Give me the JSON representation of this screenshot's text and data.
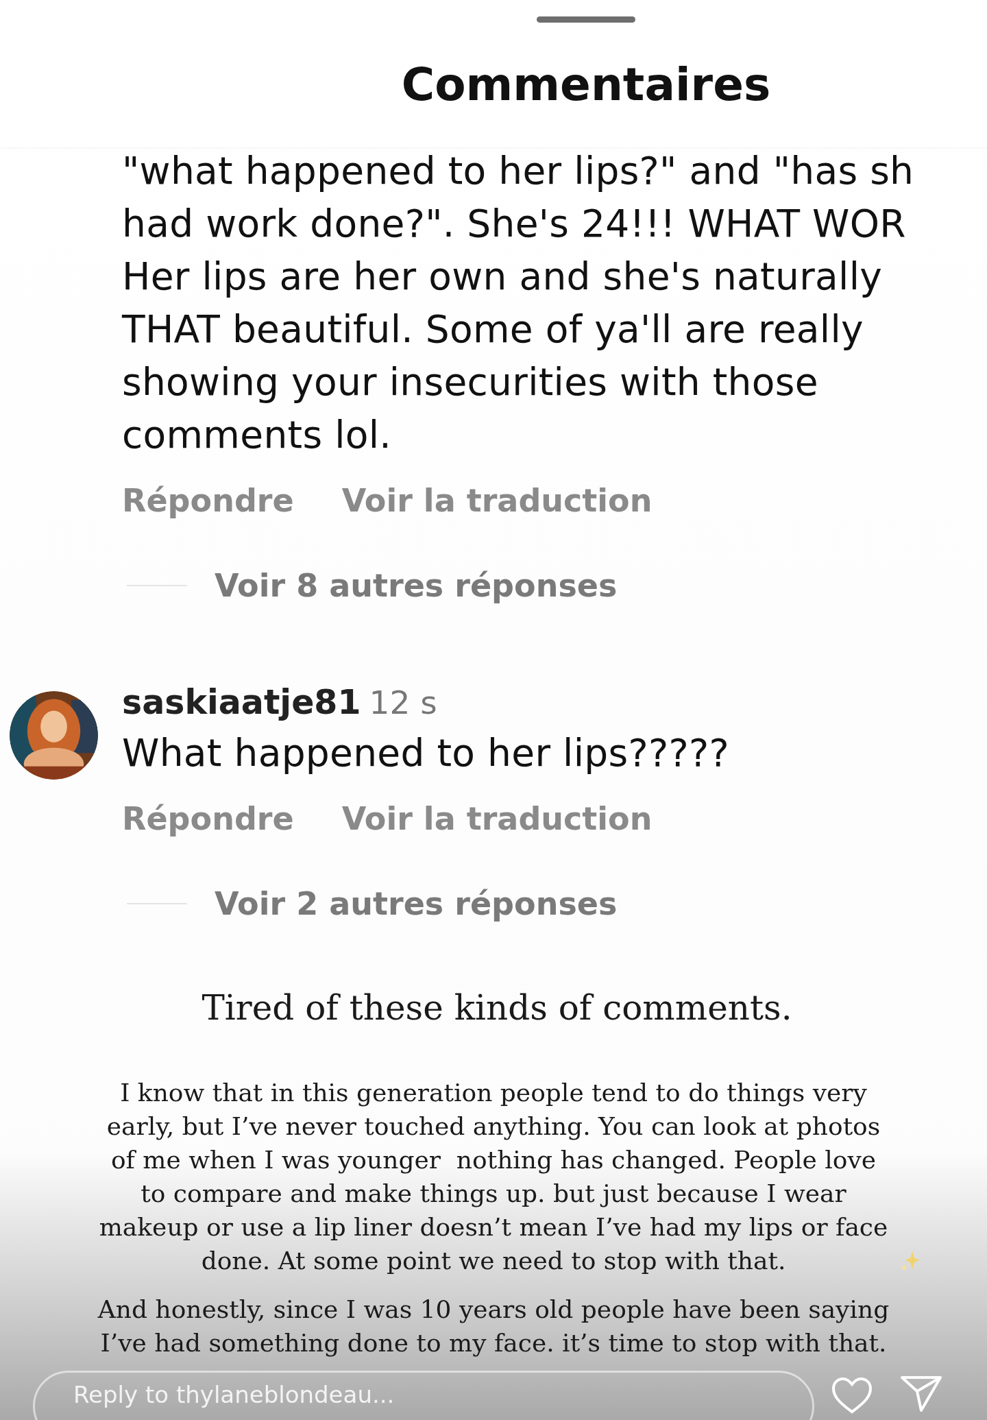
{
  "header": {
    "title": "Commentaires"
  },
  "comments": [
    {
      "has_avatar": false,
      "text": "\"what happened to her lips?\" and \"has sh\nhad work done?\". She's 24!!! WHAT WOR\nHer lips are her own and she's naturally\nTHAT beautiful. Some of ya'll are really\nshowing your insecurities with those\ncomments lol.",
      "actions": [
        "Répondre",
        "Voir la traduction"
      ],
      "replies": "Voir 8 autres réponses"
    },
    {
      "has_avatar": true,
      "username": "saskiaatje81",
      "time": "12 s",
      "text": "What happened to her lips?????",
      "actions": [
        "Répondre",
        "Voir la traduction"
      ],
      "replies": "Voir 2 autres réponses"
    }
  ],
  "story": {
    "heading": "Tired  of these kinds of comments.",
    "paragraphs": [
      {
        "text": "I know that in this generation people tend to do things very\nearly, but I’ve never touched anything. You can look at photos\nof me when I was younger  nothing has changed. People love\nto compare and make things up. but just because I wear\nmakeup or use a lip liner doesn’t mean I’ve had my lips or face\ndone. At some point we need to stop with that.",
        "sparkle": true
      },
      {
        "text": "And honestly, since I was 10 years old people have been saying\nI’ve had something done to my face. it’s time to stop with that.",
        "sparkle": false
      }
    ]
  },
  "reply_bar": {
    "placeholder": "Reply to thylaneblondeau..."
  }
}
